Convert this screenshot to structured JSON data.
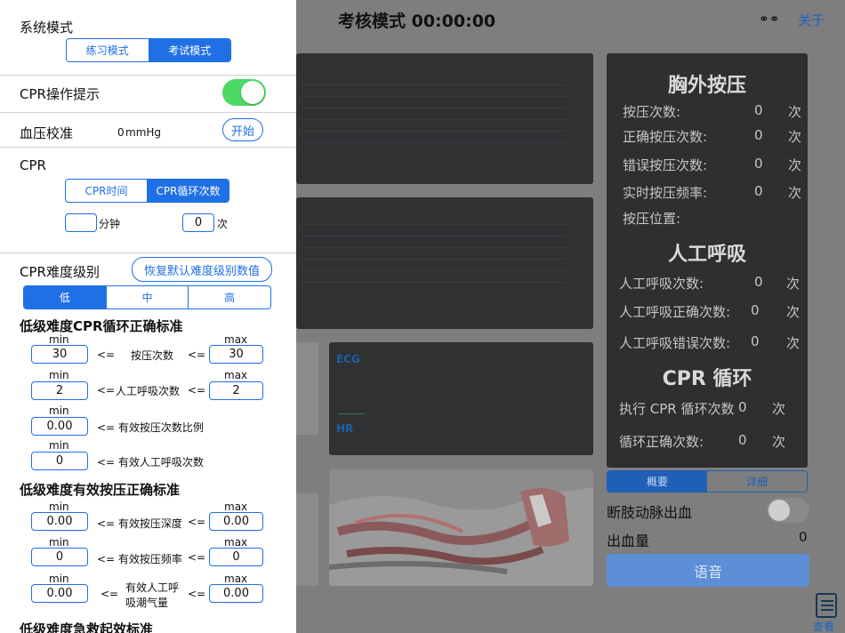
{
  "header": {
    "title": "考核模式 00:00:00",
    "about_label": "关于",
    "link_icon": "link-icon"
  },
  "stats": {
    "chest": {
      "title": "胸外按压",
      "rows": [
        {
          "label": "按压次数:",
          "value": "0",
          "unit": "次"
        },
        {
          "label": "正确按压次数:",
          "value": "0",
          "unit": "次"
        },
        {
          "label": "错误按压次数:",
          "value": "0",
          "unit": "次"
        },
        {
          "label": "实时按压频率:",
          "value": "0",
          "unit": "次"
        },
        {
          "label": "按压位置:",
          "value": "",
          "unit": ""
        }
      ]
    },
    "breath": {
      "title": "人工呼吸",
      "rows": [
        {
          "label": "人工呼吸次数:",
          "value": "0",
          "unit": "次"
        },
        {
          "label": "人工呼吸正确次数:",
          "value": "0",
          "unit": "次"
        },
        {
          "label": "人工呼吸错误次数:",
          "value": "0",
          "unit": "次"
        }
      ]
    },
    "cycle": {
      "title": "CPR 循环",
      "rows": [
        {
          "label": "执行 CPR 循环次数",
          "value": "0",
          "unit": "次"
        },
        {
          "label": "循环正确次数:",
          "value": "0",
          "unit": "次"
        }
      ]
    }
  },
  "bottom": {
    "tabs": [
      "概要",
      "详细"
    ],
    "active_tab": 0,
    "bleed_label": "断肢动脉出血",
    "blood_label": "出血量",
    "blood_value": "0",
    "voice_label": "语音",
    "view_label": "查看"
  },
  "ecg": {
    "ecg_label": "ECG",
    "hr_label": "HR",
    "ecg_color": "#1d5fa6",
    "hr_color": "#1d5fa6"
  },
  "sheet": {
    "system_mode": {
      "title": "系统模式",
      "options": [
        "练习模式",
        "考试模式"
      ],
      "selected": 1
    },
    "cpr_hint": {
      "label": "CPR操作提示",
      "enabled": true
    },
    "bp_calibration": {
      "label": "血压校准",
      "value": "0",
      "unit": "mmHg",
      "button": "开始"
    },
    "cpr": {
      "title": "CPR",
      "options": [
        "CPR时间",
        "CPR循环次数"
      ],
      "selected": 1,
      "minutes_value": "",
      "minutes_unit": "分钟",
      "count_value": "0",
      "count_unit": "次"
    },
    "difficulty": {
      "title": "CPR难度级别",
      "reset_button": "恢复默认难度级别数值",
      "levels": [
        "低",
        "中",
        "高"
      ],
      "selected": 0
    },
    "cycle_criteria": {
      "title": "低级难度CPR循环正确标准",
      "min_label": "min",
      "max_label": "max",
      "rows": [
        {
          "min": "30",
          "op1": "<=",
          "label": "按压次数",
          "op2": "<=",
          "max": "30"
        },
        {
          "min": "2",
          "op1": "<=",
          "label": "人工呼吸次数",
          "op2": "<=",
          "max": "2"
        },
        {
          "min": "0.00",
          "desc": "<= 有效按压次数比例"
        },
        {
          "min": "0",
          "desc": "<= 有效人工呼吸次数"
        }
      ]
    },
    "press_criteria": {
      "title": "低级难度有效按压正确标准",
      "rows": [
        {
          "min": "0.00",
          "desc": "<= 有效按压深度",
          "op2": "<=",
          "max": "0.00"
        },
        {
          "min": "0",
          "desc": "<= 有效按压频率",
          "op2": "<=",
          "max": "0"
        },
        {
          "min": "0.00",
          "op1": "<=",
          "label_line1": "有效人工呼",
          "label_line2": "吸潮气量",
          "op2": "<=",
          "max": "0.00"
        }
      ]
    },
    "rescue_title": "低级难度急救起效标准"
  }
}
